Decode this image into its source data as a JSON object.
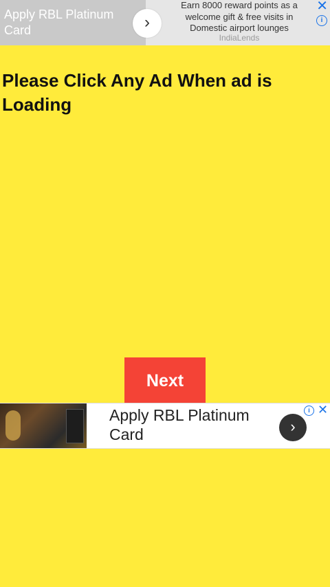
{
  "colors": {
    "background": "#FFEB3B",
    "next_button": "#F44336",
    "ad_icon": "#1a73e8"
  },
  "top_ad": {
    "headline": "Apply RBL Platinum Card",
    "arrow_icon": "chevron-right-icon",
    "body": "Earn 8000 reward points as a welcome gift & free visits in Domestic airport lounges",
    "advertiser": "IndiaLends",
    "close_icon": "close-icon",
    "info_icon": "info-icon"
  },
  "main": {
    "instruction": "Please Click Any Ad When ad is Loading",
    "next_label": "Next"
  },
  "bottom_ad": {
    "headline": "Apply RBL Platinum Card",
    "arrow_icon": "chevron-right-icon",
    "info_icon": "info-icon",
    "close_icon": "close-icon"
  },
  "glyphs": {
    "chevron": "›",
    "close": "✕",
    "info": "i"
  }
}
